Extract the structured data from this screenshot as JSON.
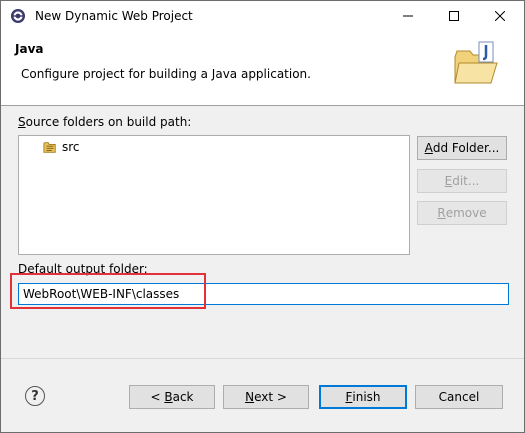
{
  "window": {
    "title": "New Dynamic Web Project"
  },
  "header": {
    "title": "Java",
    "description": "Configure project for building a Java application."
  },
  "source": {
    "label_prefix": "",
    "label_mnemonic": "S",
    "label_rest": "ource folders on build path:",
    "items": [
      "src"
    ]
  },
  "buttons": {
    "add_folder": {
      "m": "A",
      "rest": "dd Folder..."
    },
    "edit": {
      "m": "E",
      "rest": "dit..."
    },
    "remove": {
      "m": "R",
      "rest": "emove"
    }
  },
  "output": {
    "label": "Default output folder:",
    "value": "WebRoot\\WEB-INF\\classes"
  },
  "footer": {
    "back": {
      "pre": "< ",
      "m": "B",
      "rest": "ack"
    },
    "next": {
      "m": "N",
      "rest": "ext >"
    },
    "finish": {
      "m": "F",
      "rest": "inish"
    },
    "cancel": "Cancel"
  },
  "colors": {
    "highlight": "#e3313a",
    "accent": "#0078d7"
  }
}
